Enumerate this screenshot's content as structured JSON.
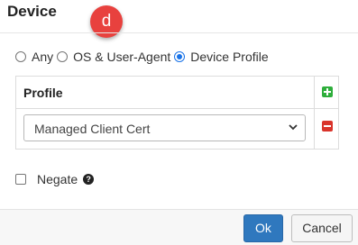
{
  "dialog": {
    "title": "Device",
    "badge": "d"
  },
  "match_mode": {
    "options": [
      {
        "label": "Any",
        "checked": false
      },
      {
        "label": "OS & User-Agent",
        "checked": false
      },
      {
        "label": "Device Profile",
        "checked": true
      }
    ]
  },
  "profile": {
    "header": "Profile",
    "selected": "Managed Client Cert",
    "add_icon": "plus-icon",
    "remove_icon": "minus-icon"
  },
  "negate": {
    "label": "Negate",
    "checked": false,
    "help_icon": "question-icon"
  },
  "footer": {
    "ok_label": "Ok",
    "cancel_label": "Cancel"
  },
  "colors": {
    "primary": "#2f78be",
    "add": "#2eae3b",
    "remove": "#d9342b",
    "badge": "#e8413e"
  }
}
